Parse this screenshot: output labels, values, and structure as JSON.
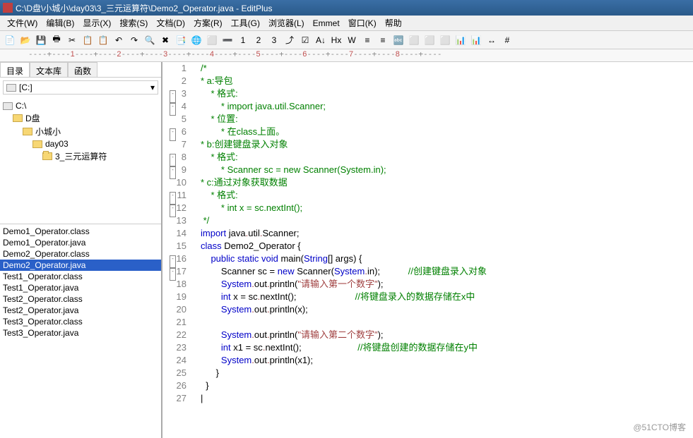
{
  "title": "C:\\D盘\\小城小\\day03\\3_三元运算符\\Demo2_Operator.java - EditPlus",
  "menus": [
    "文件(W)",
    "编辑(B)",
    "显示(X)",
    "搜索(S)",
    "文档(D)",
    "方案(R)",
    "工具(G)",
    "浏览器(L)",
    "Emmet",
    "窗口(K)",
    "帮助"
  ],
  "tabs": {
    "dir": "目录",
    "text": "文本库",
    "func": "函数"
  },
  "driveCombo": "[C:]",
  "folders": [
    {
      "name": "C:\\",
      "indent": 0,
      "type": "drive"
    },
    {
      "name": "D盘",
      "indent": 1,
      "type": "folder"
    },
    {
      "name": "小城小",
      "indent": 2,
      "type": "folder"
    },
    {
      "name": "day03",
      "indent": 3,
      "type": "folder"
    },
    {
      "name": "3_三元运算符",
      "indent": 4,
      "type": "folder-open",
      "sel": true
    }
  ],
  "files": [
    "Demo1_Operator.class",
    "Demo1_Operator.java",
    "Demo2_Operator.class",
    "Demo2_Operator.java",
    "Test1_Operator.class",
    "Test1_Operator.java",
    "Test2_Operator.class",
    "Test2_Operator.java",
    "Test3_Operator.class",
    "Test3_Operator.java"
  ],
  "selectedFile": "Demo2_Operator.java",
  "ruler": "----+----1----+----2----+----3----+----4----+----5----+----6----+----7----+----8----+----",
  "code": [
    {
      "n": 1,
      "fold": "",
      "spans": [
        {
          "t": "/*",
          "c": "c-comment"
        }
      ]
    },
    {
      "n": 2,
      "fold": "-",
      "spans": [
        {
          "t": "* a:导包",
          "c": "c-comment"
        }
      ]
    },
    {
      "n": 3,
      "fold": "-",
      "spans": [
        {
          "t": "    * 格式:",
          "c": "c-comment"
        }
      ]
    },
    {
      "n": 4,
      "fold": "",
      "spans": [
        {
          "t": "        * import java.util.Scanner;",
          "c": "c-comment"
        }
      ]
    },
    {
      "n": 5,
      "fold": "-",
      "spans": [
        {
          "t": "    * 位置:",
          "c": "c-comment"
        }
      ]
    },
    {
      "n": 6,
      "fold": "",
      "spans": [
        {
          "t": "        * 在class上面。",
          "c": "c-comment"
        }
      ]
    },
    {
      "n": 7,
      "fold": "-",
      "spans": [
        {
          "t": "* b:创建键盘录入对象",
          "c": "c-comment"
        }
      ]
    },
    {
      "n": 8,
      "fold": "-",
      "spans": [
        {
          "t": "    * 格式:",
          "c": "c-comment"
        }
      ]
    },
    {
      "n": 9,
      "fold": "",
      "spans": [
        {
          "t": "        * Scanner sc = new Scanner(System.in);",
          "c": "c-comment"
        }
      ]
    },
    {
      "n": 10,
      "fold": "-",
      "spans": [
        {
          "t": "* c:通过对象获取数据",
          "c": "c-comment"
        }
      ]
    },
    {
      "n": 11,
      "fold": "-",
      "spans": [
        {
          "t": "    * 格式:",
          "c": "c-comment"
        }
      ]
    },
    {
      "n": 12,
      "fold": "",
      "spans": [
        {
          "t": "        * int x = sc.nextInt();",
          "c": "c-comment"
        }
      ]
    },
    {
      "n": 13,
      "fold": "",
      "spans": [
        {
          "t": " */",
          "c": "c-comment"
        }
      ]
    },
    {
      "n": 14,
      "fold": "",
      "spans": [
        {
          "t": "import",
          "c": "c-keyword"
        },
        {
          "t": " java",
          "c": ""
        },
        {
          "t": ".",
          "c": "c-dot"
        },
        {
          "t": "util",
          "c": ""
        },
        {
          "t": ".",
          "c": "c-dot"
        },
        {
          "t": "Scanner",
          "c": ""
        },
        {
          "t": ";",
          "c": ""
        }
      ]
    },
    {
      "n": 15,
      "fold": "-",
      "spans": [
        {
          "t": "class",
          "c": "c-keyword"
        },
        {
          "t": " Demo2_Operator {",
          "c": ""
        }
      ]
    },
    {
      "n": 16,
      "fold": "-",
      "spans": [
        {
          "t": "    ",
          "c": ""
        },
        {
          "t": "public static void",
          "c": "c-keyword"
        },
        {
          "t": " main",
          "c": ""
        },
        {
          "t": "(",
          "c": ""
        },
        {
          "t": "String",
          "c": "c-blue"
        },
        {
          "t": "[] args) {",
          "c": ""
        }
      ]
    },
    {
      "n": 17,
      "fold": "",
      "spans": [
        {
          "t": "        Scanner sc = ",
          "c": ""
        },
        {
          "t": "new",
          "c": "c-keyword"
        },
        {
          "t": " Scanner",
          "c": ""
        },
        {
          "t": "(",
          "c": ""
        },
        {
          "t": "System",
          "c": "c-blue"
        },
        {
          "t": ".",
          "c": "c-dot"
        },
        {
          "t": "in);",
          "c": ""
        },
        {
          "t": "           ",
          "c": ""
        },
        {
          "t": "//创建键盘录入对象",
          "c": "c-comment"
        }
      ]
    },
    {
      "n": 18,
      "fold": "",
      "spans": [
        {
          "t": "        ",
          "c": ""
        },
        {
          "t": "System",
          "c": "c-blue"
        },
        {
          "t": ".",
          "c": "c-dot"
        },
        {
          "t": "out",
          "c": ""
        },
        {
          "t": ".",
          "c": "c-dot"
        },
        {
          "t": "println",
          "c": ""
        },
        {
          "t": "(",
          "c": ""
        },
        {
          "t": "\"请输入第一个数字\"",
          "c": "c-string"
        },
        {
          "t": ");",
          "c": ""
        }
      ]
    },
    {
      "n": 19,
      "fold": "",
      "spans": [
        {
          "t": "        ",
          "c": ""
        },
        {
          "t": "int",
          "c": "c-keyword"
        },
        {
          "t": " x = sc",
          "c": ""
        },
        {
          "t": ".",
          "c": "c-dot"
        },
        {
          "t": "nextInt",
          "c": ""
        },
        {
          "t": "();",
          "c": ""
        },
        {
          "t": "                       ",
          "c": ""
        },
        {
          "t": "//将键盘录入的数据存储在x中",
          "c": "c-comment"
        }
      ]
    },
    {
      "n": 20,
      "fold": "",
      "spans": [
        {
          "t": "        ",
          "c": ""
        },
        {
          "t": "System",
          "c": "c-blue"
        },
        {
          "t": ".",
          "c": "c-dot"
        },
        {
          "t": "out",
          "c": ""
        },
        {
          "t": ".",
          "c": "c-dot"
        },
        {
          "t": "println",
          "c": ""
        },
        {
          "t": "(x);",
          "c": ""
        }
      ]
    },
    {
      "n": 21,
      "fold": "",
      "spans": [
        {
          "t": "",
          "c": ""
        }
      ]
    },
    {
      "n": 22,
      "fold": "",
      "spans": [
        {
          "t": "        ",
          "c": ""
        },
        {
          "t": "System",
          "c": "c-blue"
        },
        {
          "t": ".",
          "c": "c-dot"
        },
        {
          "t": "out",
          "c": ""
        },
        {
          "t": ".",
          "c": "c-dot"
        },
        {
          "t": "println",
          "c": ""
        },
        {
          "t": "(",
          "c": ""
        },
        {
          "t": "\"请输入第二个数字\"",
          "c": "c-string"
        },
        {
          "t": ");",
          "c": ""
        }
      ]
    },
    {
      "n": 23,
      "fold": "",
      "spans": [
        {
          "t": "        ",
          "c": ""
        },
        {
          "t": "int",
          "c": "c-keyword"
        },
        {
          "t": " x1 = sc",
          "c": ""
        },
        {
          "t": ".",
          "c": "c-dot"
        },
        {
          "t": "nextInt",
          "c": ""
        },
        {
          "t": "();",
          "c": ""
        },
        {
          "t": "                      ",
          "c": ""
        },
        {
          "t": "//将键盘创建的数据存储在y中",
          "c": "c-comment"
        }
      ]
    },
    {
      "n": 24,
      "fold": "",
      "spans": [
        {
          "t": "        ",
          "c": ""
        },
        {
          "t": "System",
          "c": "c-blue"
        },
        {
          "t": ".",
          "c": "c-dot"
        },
        {
          "t": "out",
          "c": ""
        },
        {
          "t": ".",
          "c": "c-dot"
        },
        {
          "t": "println",
          "c": ""
        },
        {
          "t": "(x1);",
          "c": ""
        }
      ]
    },
    {
      "n": 25,
      "fold": "",
      "spans": [
        {
          "t": "      }",
          "c": ""
        }
      ]
    },
    {
      "n": 26,
      "fold": "",
      "spans": [
        {
          "t": "  }",
          "c": ""
        }
      ]
    },
    {
      "n": 27,
      "fold": "",
      "spans": [
        {
          "t": "|",
          "c": ""
        }
      ]
    }
  ],
  "toolbarIcons": [
    "📄",
    "📂",
    "💾",
    "🖶",
    "✂",
    "📋",
    "📋",
    "↶",
    "↷",
    "🔍",
    "✖",
    "📑",
    "🌐",
    "⬜",
    "➖",
    "1",
    "2",
    "3",
    "⤴",
    "☑",
    "A↓",
    "Hx",
    "W",
    "≡",
    "≡",
    "🔤",
    "⬜",
    "⬜",
    "⬜",
    "📊",
    "📊",
    "↔",
    "#"
  ],
  "watermark": "@51CTO博客"
}
